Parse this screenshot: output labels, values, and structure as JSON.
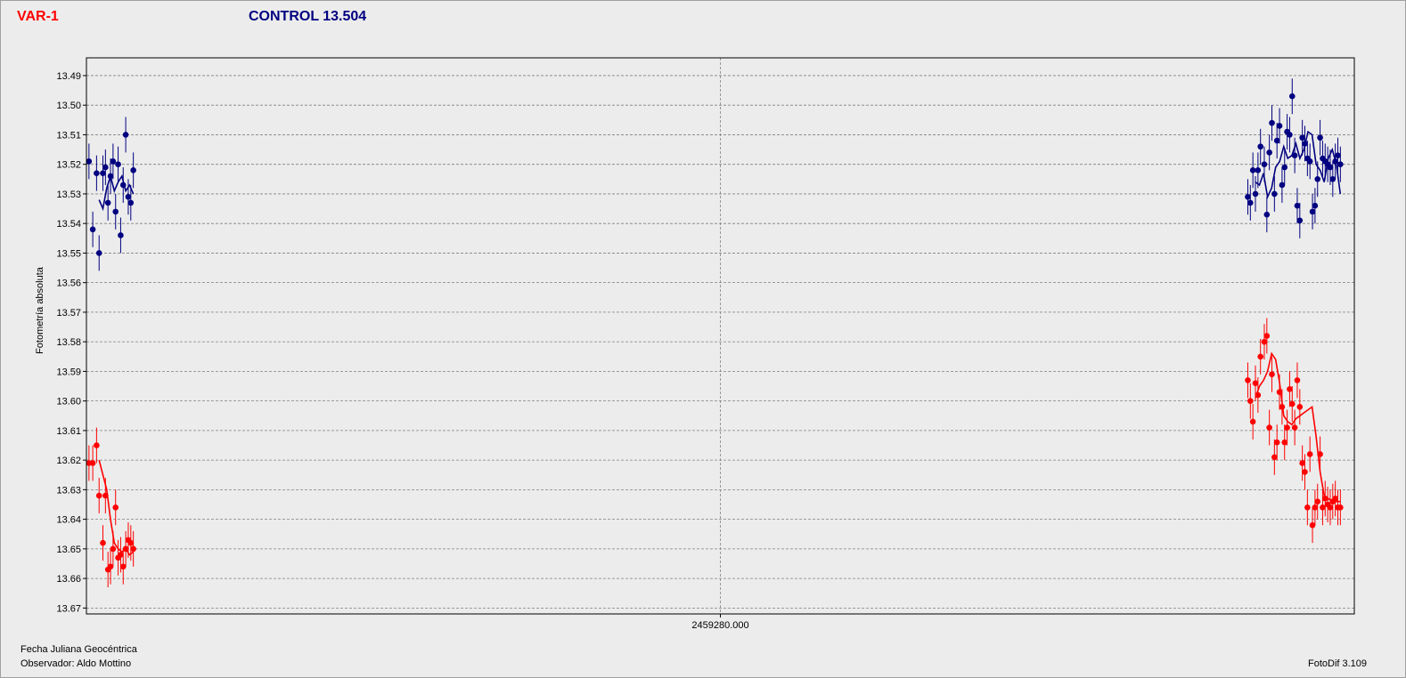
{
  "header": {
    "var_label": "VAR-1",
    "control_label": "CONTROL 13.504"
  },
  "colors": {
    "variable": "#ff0000",
    "control": "#000080",
    "background": "#ececec",
    "plot_background": "#ececec",
    "grid": "#808080"
  },
  "footer": {
    "xlabel": "Fecha Juliana Geocéntrica",
    "observer": "Observador: Aldo Mottino",
    "software": "FotoDif 3.109"
  },
  "chart_data": {
    "type": "scatter",
    "title": "",
    "ylabel": "Fotometría absoluta",
    "xlabel": "Fecha Juliana Geocéntrica",
    "y_inverted": true,
    "ylim": [
      13.484,
      13.672
    ],
    "x_range_relative": [
      0,
      100
    ],
    "y_ticks": [
      "13.49",
      "13.50",
      "13.51",
      "13.52",
      "13.53",
      "13.54",
      "13.55",
      "13.56",
      "13.57",
      "13.58",
      "13.59",
      "13.60",
      "13.61",
      "13.62",
      "13.63",
      "13.64",
      "13.65",
      "13.66",
      "13.67"
    ],
    "x_ticks": [
      {
        "label": "2459280.000",
        "x": 50
      }
    ],
    "grid": true,
    "error_bar": 0.006,
    "series": [
      {
        "name": "CONTROL 13.504",
        "color": "#000080",
        "x": [
          0.2,
          0.5,
          0.8,
          1.0,
          1.3,
          1.5,
          1.7,
          1.9,
          2.1,
          2.3,
          2.5,
          2.7,
          2.9,
          3.1,
          3.3,
          3.5,
          3.7,
          91.6,
          91.8,
          92.0,
          92.2,
          92.4,
          92.6,
          92.9,
          93.1,
          93.3,
          93.5,
          93.7,
          93.9,
          94.1,
          94.3,
          94.5,
          94.7,
          94.9,
          95.1,
          95.3,
          95.5,
          95.7,
          95.9,
          96.1,
          96.3,
          96.5,
          96.7,
          96.9,
          97.1,
          97.3,
          97.5,
          97.7,
          97.9,
          98.1,
          98.3,
          98.5,
          98.7,
          98.9
        ],
        "y": [
          13.519,
          13.542,
          13.523,
          13.55,
          13.523,
          13.521,
          13.533,
          13.524,
          13.519,
          13.536,
          13.52,
          13.544,
          13.527,
          13.51,
          13.531,
          13.533,
          13.522,
          13.531,
          13.533,
          13.522,
          13.53,
          13.522,
          13.514,
          13.52,
          13.537,
          13.516,
          13.506,
          13.53,
          13.512,
          13.507,
          13.527,
          13.521,
          13.509,
          13.51,
          13.497,
          13.517,
          13.534,
          13.539,
          13.511,
          13.513,
          13.518,
          13.519,
          13.536,
          13.534,
          13.525,
          13.511,
          13.518,
          13.519,
          13.52,
          13.521,
          13.525,
          13.519,
          13.517,
          13.52
        ],
        "trend": [
          13.532,
          13.535,
          13.528,
          13.524,
          13.529,
          13.526,
          13.524,
          13.529,
          13.527,
          13.53,
          13.526,
          13.527,
          13.523,
          13.531,
          13.528,
          13.521,
          13.519,
          13.514,
          13.518,
          13.517,
          13.513,
          13.518,
          13.515,
          13.509,
          13.51,
          13.52,
          13.522,
          13.526,
          13.518,
          13.515,
          13.52,
          13.53
        ]
      },
      {
        "name": "VAR-1",
        "color": "#ff0000",
        "x": [
          0.2,
          0.5,
          0.8,
          1.0,
          1.3,
          1.5,
          1.7,
          1.9,
          2.1,
          2.3,
          2.5,
          2.7,
          2.9,
          3.1,
          3.3,
          3.5,
          3.7,
          91.6,
          91.8,
          92.0,
          92.2,
          92.4,
          92.6,
          92.9,
          93.1,
          93.3,
          93.5,
          93.7,
          93.9,
          94.1,
          94.3,
          94.5,
          94.7,
          94.9,
          95.1,
          95.3,
          95.5,
          95.7,
          95.9,
          96.1,
          96.3,
          96.5,
          96.7,
          96.9,
          97.1,
          97.3,
          97.5,
          97.7,
          97.9,
          98.1,
          98.3,
          98.5,
          98.7,
          98.9
        ],
        "y": [
          13.621,
          13.621,
          13.615,
          13.632,
          13.648,
          13.632,
          13.657,
          13.656,
          13.65,
          13.636,
          13.653,
          13.652,
          13.656,
          13.65,
          13.647,
          13.648,
          13.65,
          13.593,
          13.6,
          13.607,
          13.594,
          13.598,
          13.585,
          13.58,
          13.578,
          13.609,
          13.591,
          13.619,
          13.614,
          13.597,
          13.602,
          13.614,
          13.609,
          13.596,
          13.601,
          13.609,
          13.593,
          13.602,
          13.621,
          13.624,
          13.636,
          13.618,
          13.642,
          13.636,
          13.634,
          13.618,
          13.636,
          13.633,
          13.635,
          13.636,
          13.634,
          13.633,
          13.636,
          13.636
        ],
        "trend": [
          13.62,
          13.625,
          13.63,
          13.64,
          13.648,
          13.65,
          13.651,
          13.65,
          13.652,
          13.651,
          13.599,
          13.595,
          13.593,
          13.59,
          13.584,
          13.586,
          13.594,
          13.605,
          13.607,
          13.608,
          13.606,
          13.605,
          13.604,
          13.603,
          13.602,
          13.612,
          13.624,
          13.632,
          13.633,
          13.634,
          13.634,
          13.634
        ]
      }
    ]
  }
}
